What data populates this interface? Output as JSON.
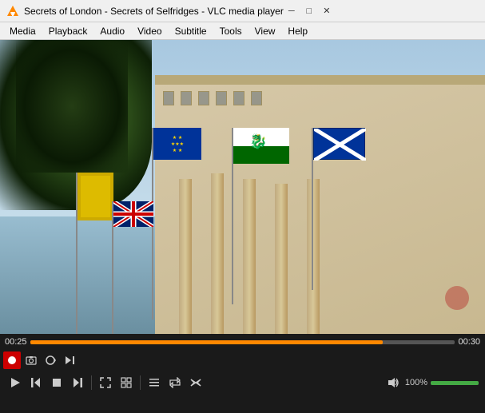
{
  "titleBar": {
    "title": "Secrets of London - Secrets of Selfridges - VLC media player",
    "minimizeLabel": "─",
    "maximizeLabel": "□",
    "closeLabel": "✕"
  },
  "menuBar": {
    "items": [
      {
        "id": "media",
        "label": "Media",
        "underline": "M"
      },
      {
        "id": "playback",
        "label": "Playback",
        "underline": "P"
      },
      {
        "id": "audio",
        "label": "Audio",
        "underline": "A"
      },
      {
        "id": "video",
        "label": "Video",
        "underline": "V"
      },
      {
        "id": "subtitle",
        "label": "Subtitle",
        "underline": "S"
      },
      {
        "id": "tools",
        "label": "Tools",
        "underline": "T"
      },
      {
        "id": "view",
        "label": "View",
        "underline": "V"
      },
      {
        "id": "help",
        "label": "Help",
        "underline": "H"
      }
    ]
  },
  "player": {
    "currentTime": "00:25",
    "totalTime": "00:30",
    "progressPercent": 83,
    "volumePercent": 100,
    "volumeLabel": "100%"
  },
  "controls": {
    "row1": {
      "record": "⏺",
      "snapshot": "📷",
      "loop": "⟳",
      "frame": "▶|"
    },
    "row2": {
      "play": "▶",
      "prev": "⏮",
      "stop": "⏹",
      "next": "⏭",
      "fullscreen": "⛶",
      "extended": "⊞",
      "playlist": "≡",
      "repeat": "⟳",
      "random": "⤢",
      "volume": "🔊"
    }
  }
}
